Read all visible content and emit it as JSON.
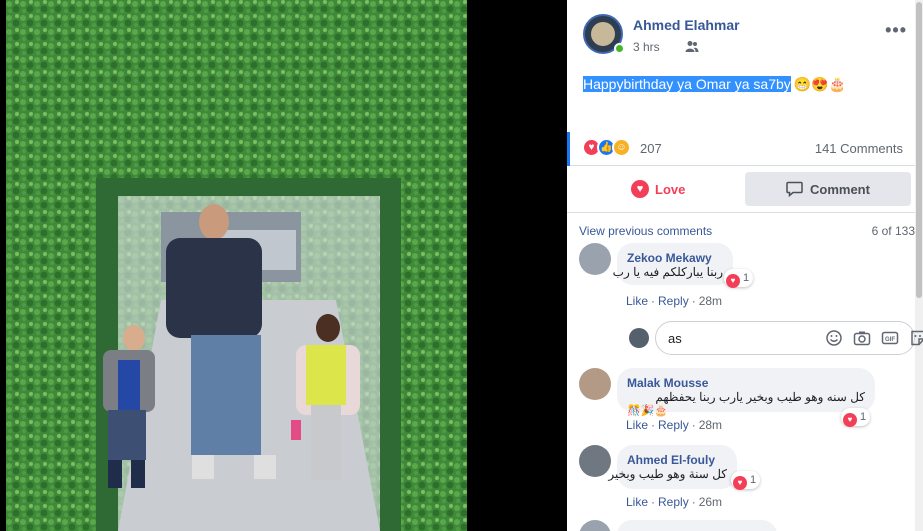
{
  "post": {
    "author": "Ahmed Elahmar",
    "time": "3 hrs",
    "text": "Happybirthday ya Omar ya sa7by",
    "emojis": "😁😍🎂",
    "reaction_count": "207",
    "comments_count": "141 Comments",
    "love_label": "Love",
    "comment_label": "Comment",
    "more": "•••"
  },
  "comments_section": {
    "view_previous": "View previous comments",
    "pager": "6 of 133",
    "reply_value": "as",
    "like": "Like",
    "reply": "Reply"
  },
  "comments": [
    {
      "name": "Zekoo Mekawy",
      "text": "ربنا يباركلكم فيه يا رب",
      "reactions": "1",
      "time": "28m"
    },
    {
      "name": "Malak Mousse",
      "text": "كل سنه وهو طيب وبخير يارب ربنا يحفظهم",
      "extra": "🎊🎉🎂",
      "reactions": "1",
      "time": "28m"
    },
    {
      "name": "Ahmed El-fouly",
      "text": "كل سنة وهو طيب وبخير",
      "reactions": "1",
      "time": "26m"
    }
  ],
  "colors": {
    "link": "#385898",
    "love": "#f33e58",
    "like": "#1877f2",
    "bubble": "#f0f2f5"
  }
}
